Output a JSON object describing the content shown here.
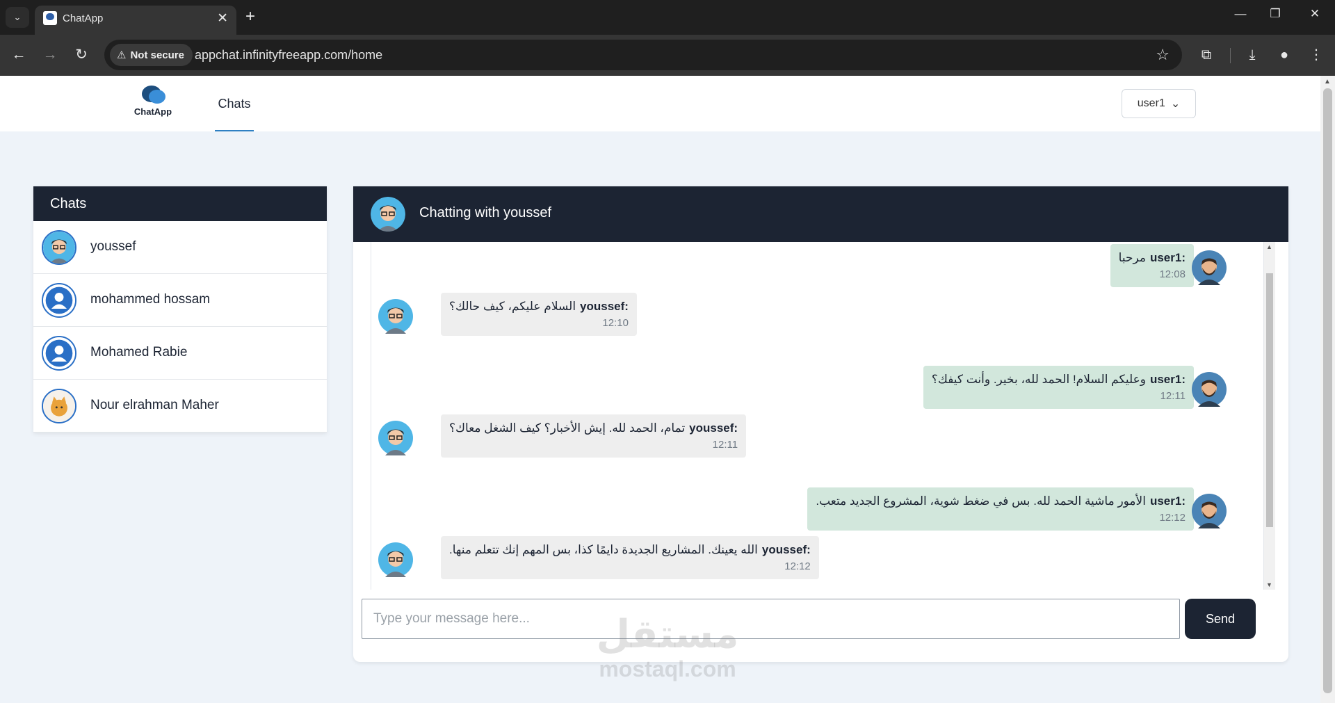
{
  "browser": {
    "tab_title": "ChatApp",
    "security_label": "Not secure",
    "url": "appchat.infinityfreeapp.com/home"
  },
  "header": {
    "logo_text": "ChatApp",
    "nav_chats": "Chats",
    "user_menu": "user1"
  },
  "sidebar": {
    "title": "Chats",
    "items": [
      {
        "name": "youssef",
        "avatar": "cartoon-man-glasses"
      },
      {
        "name": "mohammed hossam",
        "avatar": "default-user"
      },
      {
        "name": "Mohamed Rabie",
        "avatar": "default-user"
      },
      {
        "name": "Nour elrahman Maher",
        "avatar": "cat-avatar"
      }
    ]
  },
  "conversation": {
    "title": "Chatting with youssef",
    "messages": [
      {
        "from": "me",
        "sender": "user1:",
        "text": "مرحبا",
        "time": "12:08"
      },
      {
        "from": "them",
        "sender": "youssef:",
        "text": "السلام عليكم، كيف حالك؟",
        "time": "12:10"
      },
      {
        "from": "me",
        "sender": "user1:",
        "text": "وعليكم السلام! الحمد لله، بخير. وأنت كيفك؟",
        "time": "12:11"
      },
      {
        "from": "them",
        "sender": "youssef:",
        "text": "تمام، الحمد لله. إيش الأخبار؟ كيف الشغل معاك؟",
        "time": "12:11"
      },
      {
        "from": "me",
        "sender": "user1:",
        "text": "الأمور ماشية الحمد لله. بس في ضغط شوية، المشروع الجديد متعب.",
        "time": "12:12"
      },
      {
        "from": "them",
        "sender": "youssef:",
        "text": "الله يعينك. المشاريع الجديدة دايمًا كذا، بس المهم إنك تتعلم منها.",
        "time": "12:12"
      }
    ],
    "input_placeholder": "Type your message here...",
    "send_label": "Send"
  },
  "watermark": {
    "arabic": "مستقل",
    "latin": "mostaql.com"
  },
  "colors": {
    "navy": "#1c2433",
    "my_bubble": "#d2e7dc",
    "their_bubble": "#eeeeee",
    "accent": "#2f80c3"
  }
}
